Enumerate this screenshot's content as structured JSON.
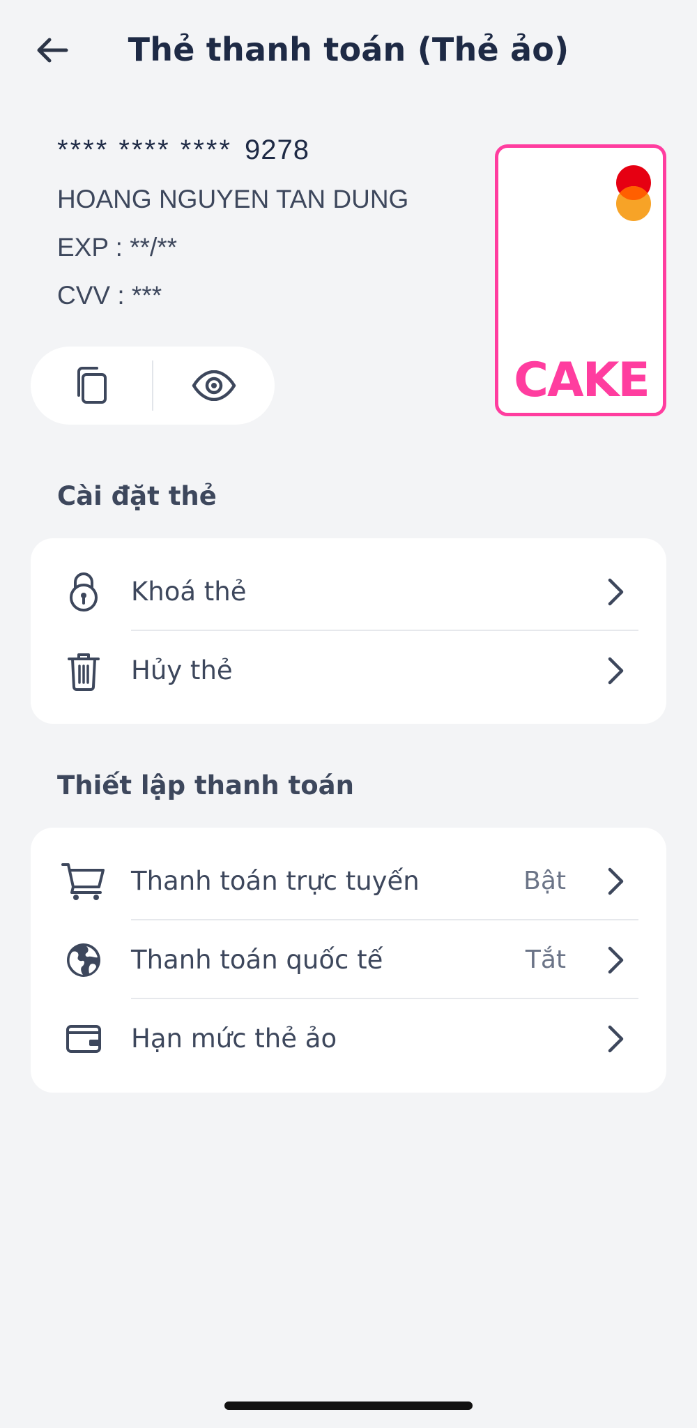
{
  "header": {
    "title": "Thẻ thanh toán (Thẻ ảo)",
    "back_icon": "arrow-left-icon"
  },
  "card": {
    "number_mask": "**** **** ****",
    "number_last4": "9278",
    "holder": "HOANG NGUYEN TAN DUNG",
    "exp": "EXP  : **/**",
    "cvv": "CVV : ***",
    "brand_text": "CAKE",
    "actions": [
      {
        "icon": "copy-icon"
      },
      {
        "icon": "eye-icon"
      }
    ]
  },
  "card_settings": {
    "title": "Cài đặt thẻ",
    "items": [
      {
        "label": "Khoá thẻ",
        "icon": "lock-icon",
        "value": ""
      },
      {
        "label": "Hủy thẻ",
        "icon": "trash-icon",
        "value": ""
      }
    ]
  },
  "payment_settings": {
    "title": "Thiết lập thanh toán",
    "items": [
      {
        "label": "Thanh toán trực tuyến",
        "icon": "cart-icon",
        "value": "Bật"
      },
      {
        "label": "Thanh toán quốc tế",
        "icon": "globe-icon",
        "value": "Tắt"
      },
      {
        "label": "Hạn mức thẻ ảo",
        "icon": "wallet-icon",
        "value": ""
      }
    ]
  },
  "colors": {
    "background": "#f3f4f6",
    "panel": "#ffffff",
    "text_primary": "#1e2a45",
    "text_secondary": "#3d475c",
    "brand_pink": "#ff3d9f"
  }
}
